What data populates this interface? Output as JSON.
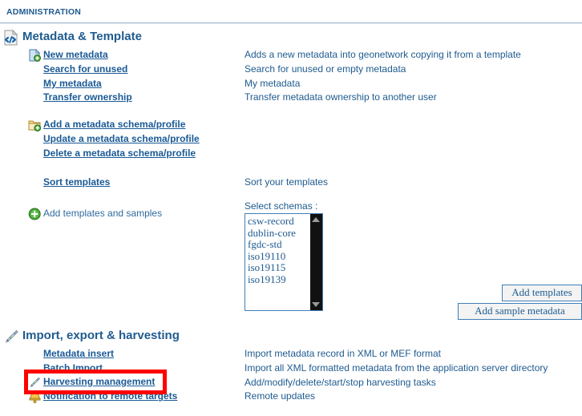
{
  "breadcrumb": {
    "label": "ADMINISTRATION"
  },
  "colors": {
    "link": "#1a5a96",
    "text": "#1f5b8f",
    "highlight": "#ff0000",
    "listbox_border": "#3f7fb5",
    "scrollbar": "#111111"
  },
  "sections": [
    {
      "id": "metadata",
      "title": "Metadata & Template",
      "icon": "code-page-icon",
      "rows": [
        {
          "label": "New metadata",
          "type": "link",
          "icon": "page-add-icon",
          "desc": "Adds a new metadata into geonetwork copying it from a template"
        },
        {
          "label": "Search for unused",
          "type": "link",
          "icon": null,
          "desc": "Search for unused or empty metadata"
        },
        {
          "label": "My metadata",
          "type": "link",
          "icon": null,
          "desc": "My metadata"
        },
        {
          "label": "Transfer ownership",
          "type": "link",
          "icon": null,
          "desc": "Transfer metadata ownership to another user"
        },
        {
          "label": "",
          "type": "spacer",
          "icon": null,
          "desc": ""
        },
        {
          "label": "Add a metadata schema/profile",
          "type": "link",
          "icon": "folder-add-icon",
          "desc": ""
        },
        {
          "label": "Update a metadata schema/profile",
          "type": "link",
          "icon": null,
          "desc": ""
        },
        {
          "label": "Delete a metadata schema/profile",
          "type": "link",
          "icon": null,
          "desc": ""
        },
        {
          "label": "",
          "type": "spacer",
          "icon": null,
          "desc": ""
        },
        {
          "label": "Sort templates",
          "type": "link",
          "icon": null,
          "desc": "Sort your templates"
        },
        {
          "label": "",
          "type": "spacer",
          "icon": null,
          "desc": ""
        },
        {
          "label": "Add templates and samples",
          "type": "plain",
          "icon": "green-plus-icon",
          "desc": ""
        }
      ]
    },
    {
      "id": "import",
      "title": "Import, export & harvesting",
      "icon": "pen-icon",
      "rows": [
        {
          "label": "Metadata insert",
          "type": "link",
          "icon": null,
          "desc": "Import metadata record in XML or MEF format"
        },
        {
          "label": "Batch Import",
          "type": "link",
          "icon": null,
          "desc": "Import all XML formatted metadata from the application server directory"
        },
        {
          "label": "Harvesting management",
          "type": "link",
          "icon": "pen-icon",
          "desc": "Add/modify/delete/start/stop harvesting tasks"
        },
        {
          "label": "Notification to remote targets",
          "type": "link",
          "icon": "bell-icon",
          "desc": "Remote updates"
        }
      ]
    }
  ],
  "schema_select": {
    "label": "Select schemas :",
    "options": [
      "csw-record",
      "dublin-core",
      "fgdc-std",
      "iso19110",
      "iso19115",
      "iso19139"
    ],
    "scrollbar": {
      "up": "scroll-up-arrow",
      "down": "scroll-down-arrow"
    }
  },
  "buttons": {
    "add_templates": "Add templates",
    "add_sample_metadata": "Add sample metadata"
  },
  "annotation": {
    "target": "Harvesting management",
    "shape": "red-rectangle"
  }
}
